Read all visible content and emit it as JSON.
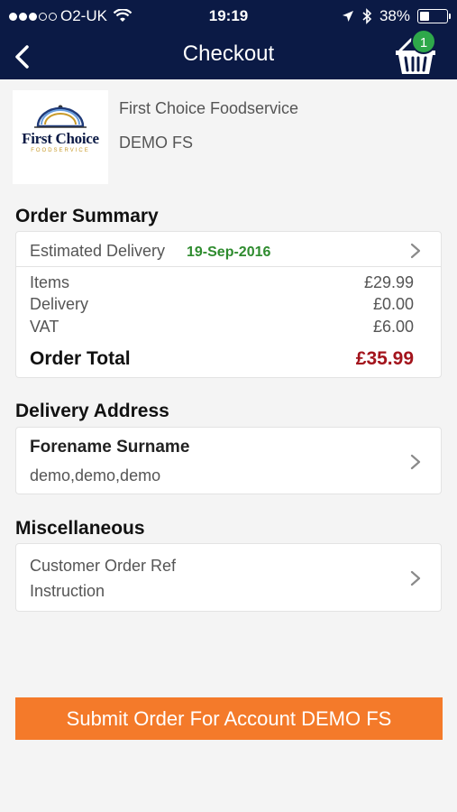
{
  "status_bar": {
    "carrier": "O2-UK",
    "time": "19:19",
    "battery": "38%",
    "battery_level": 0.38
  },
  "nav": {
    "title": "Checkout",
    "cart_count": "1"
  },
  "customer": {
    "logo_text": "First Choice",
    "logo_sub": "FOODSERVICE",
    "name": "First Choice Foodservice",
    "code": "DEMO FS"
  },
  "order_summary": {
    "title": "Order Summary",
    "estimated_delivery_label": "Estimated Delivery",
    "estimated_delivery_date": "19-Sep-2016",
    "lines": [
      {
        "label": "Items",
        "value": "£29.99"
      },
      {
        "label": "Delivery",
        "value": "£0.00"
      },
      {
        "label": "VAT",
        "value": "£6.00"
      }
    ],
    "total_label": "Order Total",
    "total_value": "£35.99"
  },
  "delivery_address": {
    "title": "Delivery Address",
    "name": "Forename Surname",
    "address": "demo,demo,demo"
  },
  "misc": {
    "title": "Miscellaneous",
    "order_ref": "Customer Order Ref",
    "instruction": "Instruction"
  },
  "submit_label": "Submit Order For Account DEMO FS",
  "colors": {
    "nav_bg": "#0b1a45",
    "delivery_date": "#2e8b2e",
    "total": "#a3141c",
    "submit_bg": "#f47a2a",
    "badge": "#2ea84a"
  }
}
